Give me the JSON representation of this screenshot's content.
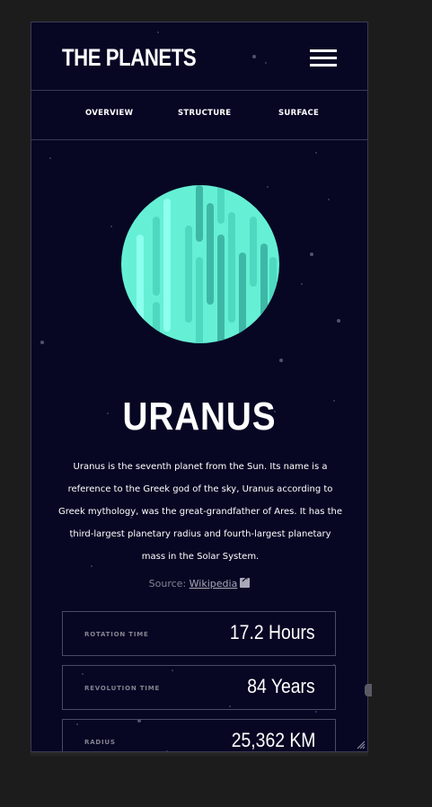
{
  "header": {
    "logo": "THE PLANETS",
    "menu_icon": "hamburger-menu-icon"
  },
  "tabs": [
    {
      "label": "OVERVIEW"
    },
    {
      "label": "STRUCTURE"
    },
    {
      "label": "SURFACE"
    }
  ],
  "planet": {
    "name": "URANUS",
    "description": "Uranus is the seventh planet from the Sun. Its name is a reference to the Greek god of the sky, Uranus according to Greek mythology, was the great-grandfather of Ares. It has the third-largest planetary radius and fourth-largest planetary mass in the Solar System.",
    "source_prefix": "Source:",
    "source_link": "Wikipedia",
    "source_icon": "external-link-icon",
    "colors": {
      "light": "#65F0D5",
      "mid": "#4FD8C0",
      "dark": "#3EB8A6",
      "highlight": "#8CFFEE"
    }
  },
  "stats": [
    {
      "label": "ROTATION TIME",
      "value": "17.2 Hours"
    },
    {
      "label": "REVOLUTION TIME",
      "value": "84 Years"
    },
    {
      "label": "RADIUS",
      "value": "25,362 KM"
    }
  ],
  "theme": {
    "background": "#070724",
    "border": "#38384F",
    "muted": "#838391"
  }
}
